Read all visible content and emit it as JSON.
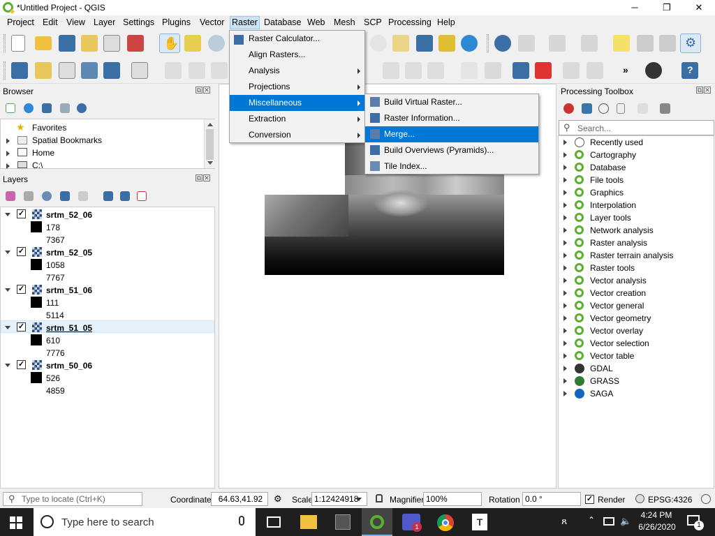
{
  "window": {
    "title": "*Untitled Project - QGIS",
    "minimize": "─",
    "maximize": "❐",
    "close": "✕"
  },
  "menubar": [
    "Project",
    "Edit",
    "View",
    "Layer",
    "Settings",
    "Plugins",
    "Vector",
    "Raster",
    "Database",
    "Web",
    "Mesh",
    "SCP",
    "Processing",
    "Help"
  ],
  "browser": {
    "title": "Browser",
    "items": [
      "Favorites",
      "Spatial Bookmarks",
      "Home",
      "C:\\"
    ]
  },
  "layers": {
    "title": "Layers",
    "items": [
      {
        "name": "srtm_52_06",
        "max": "178",
        "min": "7367"
      },
      {
        "name": "srtm_52_05",
        "max": "1058",
        "min": "7767"
      },
      {
        "name": "srtm_51_06",
        "max": "111",
        "min": "5114"
      },
      {
        "name": "srtm_51_05",
        "max": "610",
        "min": "7776"
      },
      {
        "name": "srtm_50_06",
        "max": "526",
        "min": "4859"
      }
    ]
  },
  "raster_menu": {
    "items": [
      "Raster Calculator...",
      "Align Rasters...",
      "Analysis",
      "Projections",
      "Miscellaneous",
      "Extraction",
      "Conversion"
    ]
  },
  "misc_submenu": {
    "items": [
      "Build Virtual Raster...",
      "Raster Information...",
      "Merge...",
      "Build Overviews (Pyramids)...",
      "Tile Index..."
    ]
  },
  "processing": {
    "title": "Processing Toolbox",
    "search_placeholder": "Search...",
    "items": [
      "Recently used",
      "Cartography",
      "Database",
      "File tools",
      "Graphics",
      "Interpolation",
      "Layer tools",
      "Network analysis",
      "Raster analysis",
      "Raster terrain analysis",
      "Raster tools",
      "Vector analysis",
      "Vector creation",
      "Vector general",
      "Vector geometry",
      "Vector overlay",
      "Vector selection",
      "Vector table",
      "GDAL",
      "GRASS",
      "SAGA"
    ]
  },
  "statusbar": {
    "locate_placeholder": "Type to locate (Ctrl+K)",
    "coordinate_label": "Coordinate",
    "coordinate_value": "64.63,41.92",
    "scale_label": "Scale",
    "scale_value": "1:12424918",
    "magnifier_label": "Magnifier",
    "magnifier_value": "100%",
    "rotation_label": "Rotation",
    "rotation_value": "0.0 °",
    "render_label": "Render",
    "crs": "EPSG:4326"
  },
  "taskbar": {
    "search_placeholder": "Type here to search",
    "time": "4:24 PM",
    "date": "6/26/2020",
    "notification_count": "1"
  }
}
